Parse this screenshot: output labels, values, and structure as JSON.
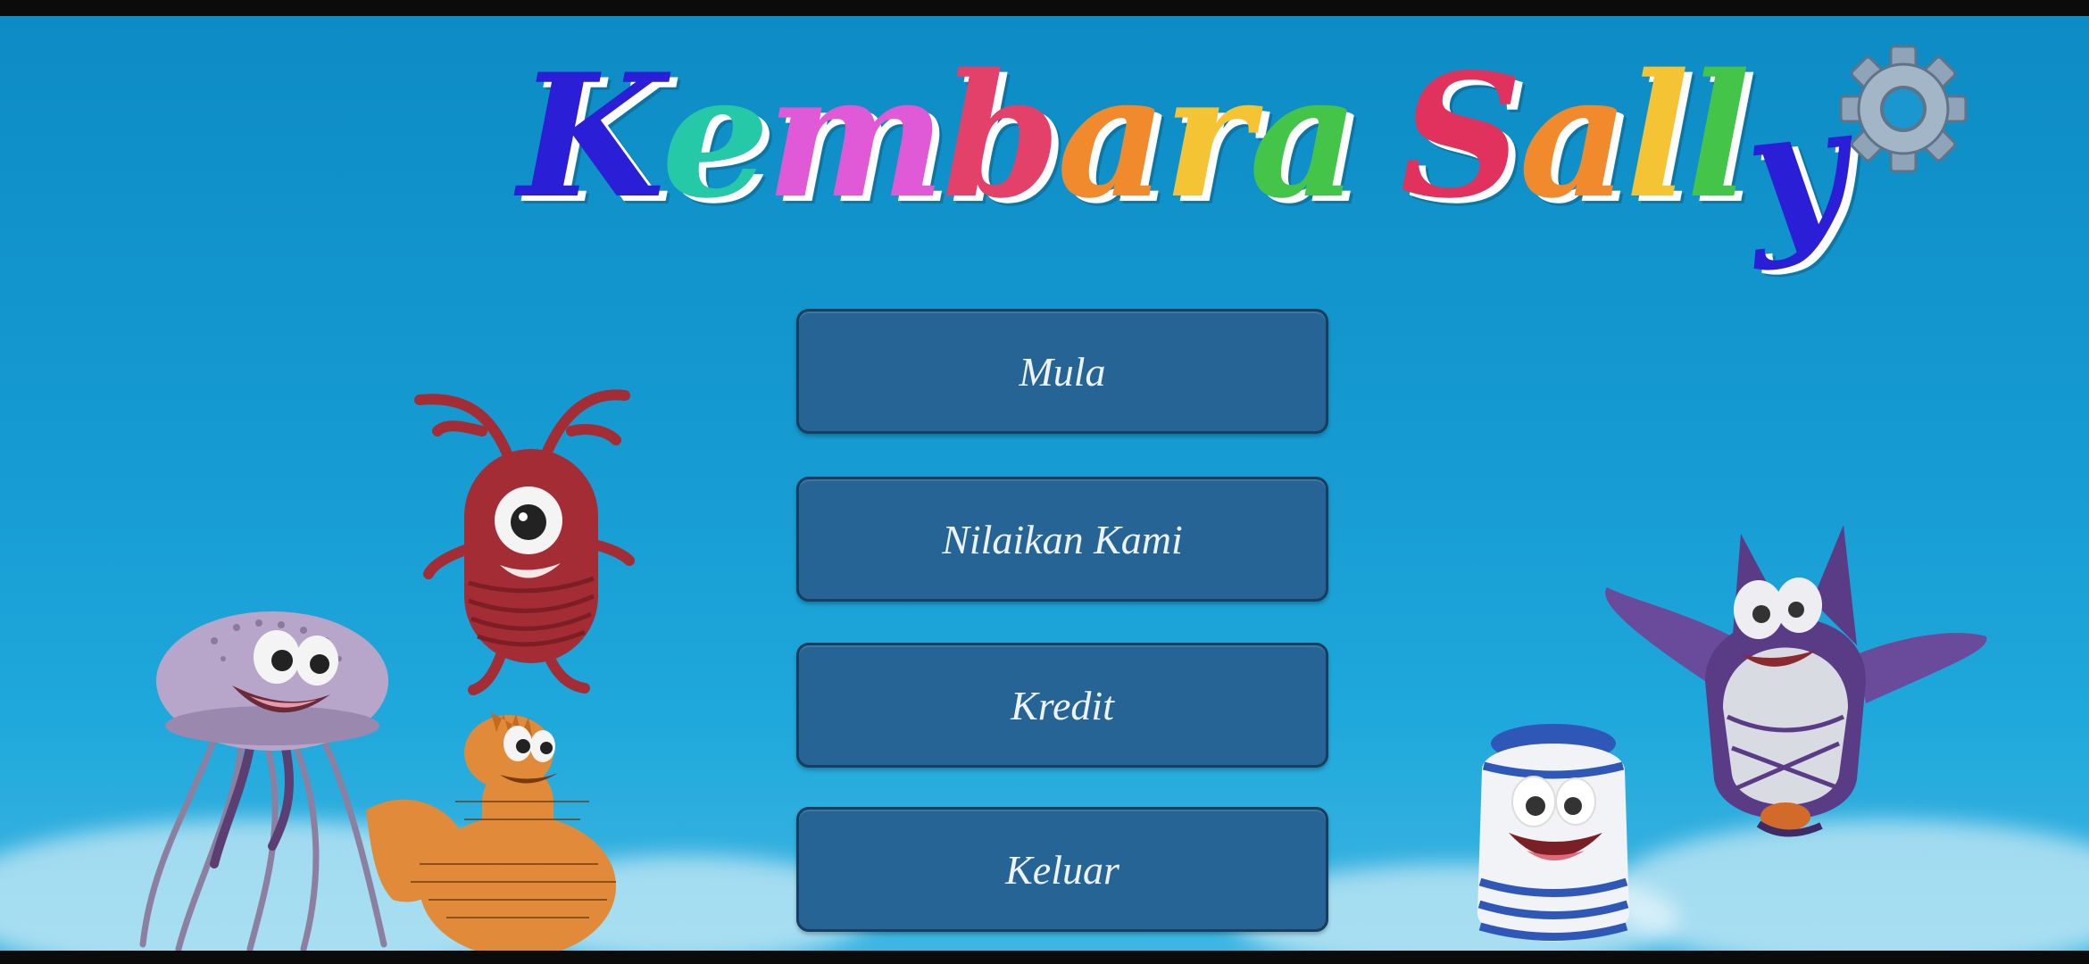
{
  "title": {
    "text": "Kembara Sally",
    "letter_colors": [
      "#2a1fd6",
      "#26c9a7",
      "#e05ad7",
      "#e3406a",
      "#f08a2c",
      "#f4c435",
      "#45c44a",
      "#e0325c",
      "#f08a2c",
      "#f4c435",
      "#45c44a",
      "#2a1fd6"
    ]
  },
  "settings": {
    "icon": "gear-icon",
    "color": "#8fa4b8"
  },
  "menu": {
    "start_label": "Mula",
    "rate_label": "Nilaikan Kami",
    "credits_label": "Kredit",
    "exit_label": "Keluar"
  },
  "colors": {
    "background": "#159ad1",
    "button_fill": "#276496",
    "button_border": "#173d5f",
    "button_text": "#eef4fb"
  },
  "characters": [
    "jellyfish",
    "red-one-eyed-creature",
    "orange-bird-creature",
    "blue-white-striped-creature",
    "purple-horned-creature"
  ]
}
